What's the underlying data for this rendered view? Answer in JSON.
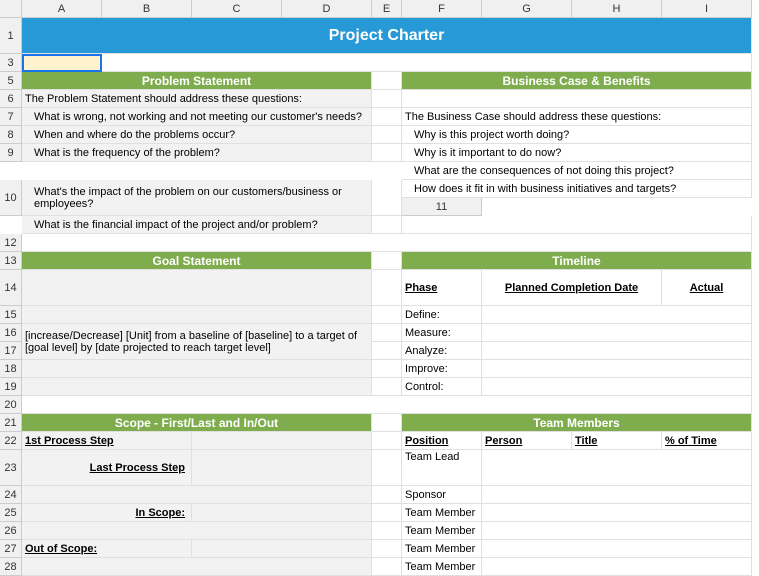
{
  "cols": [
    "A",
    "B",
    "C",
    "D",
    "E",
    "F",
    "G",
    "H",
    "I"
  ],
  "rows": [
    "1",
    "3",
    "5",
    "6",
    "7",
    "8",
    "9",
    "10",
    "11",
    "12",
    "13",
    "14",
    "15",
    "16",
    "17",
    "18",
    "19",
    "20",
    "21",
    "22",
    "23",
    "24",
    "25",
    "26",
    "27",
    "28"
  ],
  "title": "Project Charter",
  "problem": {
    "header": "Problem Statement",
    "lead": "The Problem Statement should address these questions:",
    "q1": "What is wrong, not working and not meeting our customer's needs?",
    "q2": "When and where do the problems occur?",
    "q3": "What is the frequency of the problem?",
    "q4": "What's the impact of the problem on our customers/business or employees?",
    "q5": "What is the financial impact of the project and/or problem?"
  },
  "business": {
    "header": "Business Case & Benefits",
    "lead": "The Business Case should address these questions:",
    "q1": "Why is this project worth doing?",
    "q2": "Why is it important to do now?",
    "q3": "What are the consequences of not doing this project?",
    "q4": "How does it fit in with business initiatives and targets?"
  },
  "goal": {
    "header": "Goal Statement",
    "text": "[increase/Decrease] [Unit] from a baseline of [baseline] to a target of [goal level] by [date projected to reach target level]"
  },
  "timeline": {
    "header": "Timeline",
    "phase_h": "Phase",
    "planned_h": "Planned Completion Date",
    "actual_h": "Actual",
    "p1": "Define:",
    "p2": "Measure:",
    "p3": "Analyze:",
    "p4": "Improve:",
    "p5": "Control:"
  },
  "scope": {
    "header": "Scope - First/Last and In/Out",
    "first": "1st Process Step",
    "last": "Last Process Step",
    "in": "In Scope:",
    "out": "Out of Scope:"
  },
  "team": {
    "header": "Team Members",
    "pos_h": "Position",
    "person_h": "Person",
    "title_h": "Title",
    "pct_h": "% of Time",
    "r1": "Team Lead",
    "r2": "Sponsor",
    "r3": "Team Member",
    "r4": "Team Member",
    "r5": "Team Member",
    "r6": "Team Member"
  }
}
